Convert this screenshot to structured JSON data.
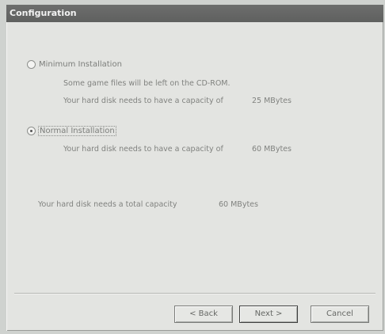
{
  "dialog": {
    "title": "Configuration",
    "options": [
      {
        "label": "Minimum Installation",
        "selected": false,
        "lines": [
          "Some game files will be left on the CD-ROM.",
          "Your hard disk needs to have a capacity of"
        ],
        "capacity": "25 MBytes"
      },
      {
        "label": "Normal Installation",
        "selected": true,
        "lines": [
          "Your hard disk needs to have a capacity of"
        ],
        "capacity": "60 MBytes"
      }
    ],
    "total": {
      "label": "Your hard disk needs a total capacity",
      "value": "60 MBytes"
    },
    "buttons": {
      "back": "< Back",
      "next": "Next >",
      "cancel": "Cancel"
    }
  }
}
